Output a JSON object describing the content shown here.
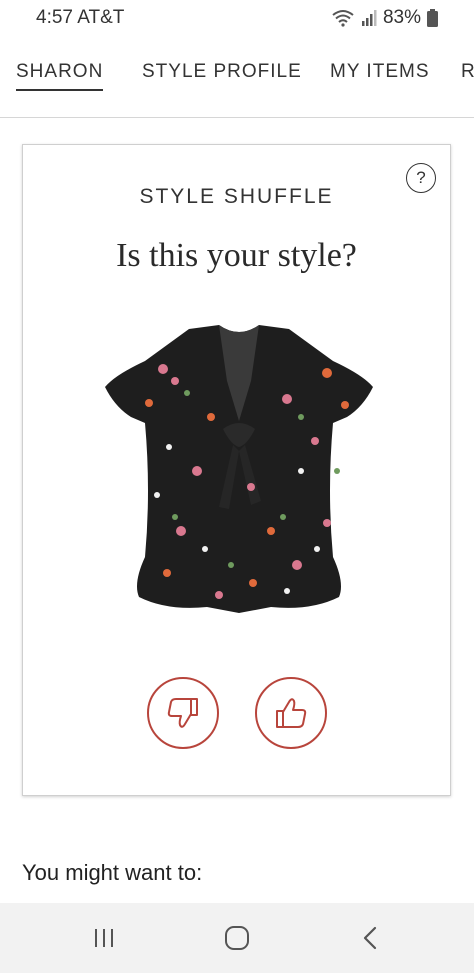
{
  "status_bar": {
    "time": "4:57 AT&T",
    "battery": "83%",
    "icons": [
      "wifi-icon",
      "signal-icon",
      "battery-icon"
    ]
  },
  "tabs": [
    {
      "label": "SHARON",
      "active": true
    },
    {
      "label": "STYLE PROFILE",
      "active": false
    },
    {
      "label": "MY ITEMS",
      "active": false
    },
    {
      "label": "R",
      "active": false
    }
  ],
  "card": {
    "help_label": "?",
    "eyebrow": "STYLE SHUFFLE",
    "question": "Is this your style?",
    "image_icon": "floral-blouse-image",
    "dislike_icon": "thumbs-down-icon",
    "like_icon": "thumbs-up-icon"
  },
  "section": {
    "heading": "You might want to:"
  },
  "nav": {
    "icons": [
      "recent-apps-icon",
      "home-icon",
      "back-icon"
    ]
  },
  "colors": {
    "accent": "#b8453c",
    "text": "#222222",
    "card_border": "#cfcfcf",
    "nav_bg": "#f2f2f2"
  }
}
